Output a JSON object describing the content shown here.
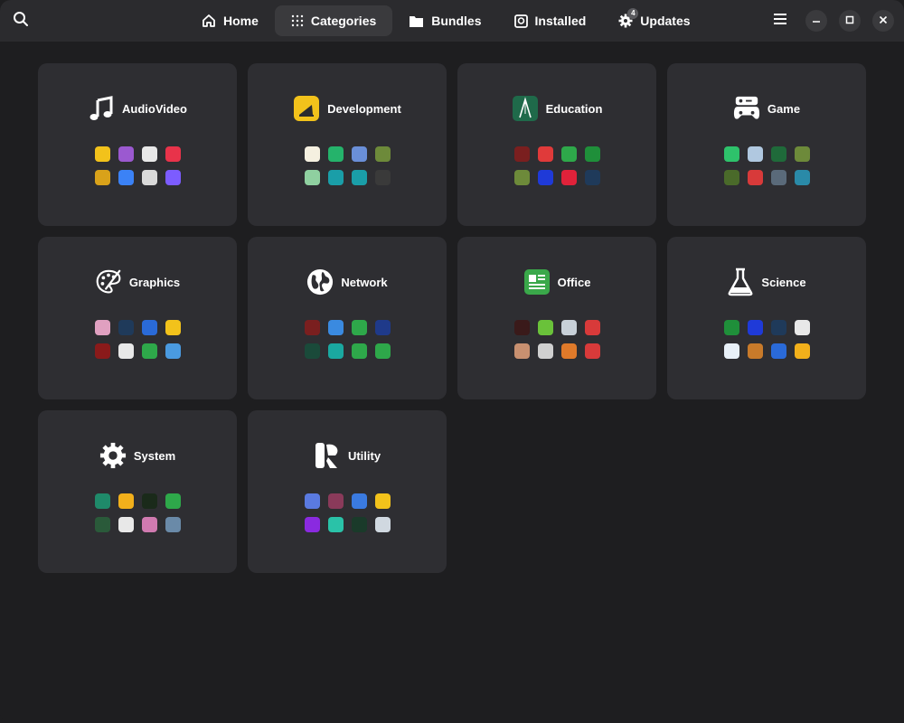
{
  "header": {
    "search_icon": "search-icon",
    "tabs": [
      {
        "label": "Home",
        "icon": "home-icon"
      },
      {
        "label": "Categories",
        "icon": "grid-icon"
      },
      {
        "label": "Bundles",
        "icon": "folder-icon"
      },
      {
        "label": "Installed",
        "icon": "installed-icon"
      },
      {
        "label": "Updates",
        "icon": "gear-icon",
        "badge": "4"
      }
    ],
    "active_tab": "Categories",
    "menu_icon": "hamburger-menu-icon",
    "window_controls": [
      "minimize-icon",
      "maximize-icon",
      "close-icon"
    ]
  },
  "categories": [
    {
      "title": "AudioVideo",
      "icon": "music-note-icon",
      "apps": [
        "#f2c21b",
        "#9b59d0",
        "#e8e8e8",
        "#e8334a",
        "#d9a21a",
        "#3b82f6",
        "#d9d9d9",
        "#7c5cff"
      ]
    },
    {
      "title": "Development",
      "icon": "development-icon",
      "apps": [
        "#f5f0e0",
        "#25b36b",
        "#6a8fd8",
        "#6d8a3a",
        "#8fd0a0",
        "#1a9ea8",
        "#1a9ea8",
        "#3a3a3a"
      ]
    },
    {
      "title": "Education",
      "icon": "education-icon",
      "apps": [
        "#7a1f1f",
        "#e03a3a",
        "#2ea84a",
        "#1f8f3a",
        "#6d8a3a",
        "#1f3ad8",
        "#e0223a",
        "#1f3a5a"
      ]
    },
    {
      "title": "Game",
      "icon": "gamepad-icon",
      "apps": [
        "#2ec26b",
        "#b0c8e0",
        "#1f6a3a",
        "#6d8a3a",
        "#4a6a2a",
        "#d83a3a",
        "#5a6a7a",
        "#2a8aa8"
      ]
    },
    {
      "title": "Graphics",
      "icon": "palette-icon",
      "apps": [
        "#e0a0c0",
        "#1f3a5a",
        "#2a6ad8",
        "#f2c21b",
        "#8a1a1a",
        "#e8e8e8",
        "#2ea84a",
        "#4a9ae0"
      ]
    },
    {
      "title": "Network",
      "icon": "globe-icon",
      "apps": [
        "#7a1f1f",
        "#3a8ae0",
        "#2ea84a",
        "#1f3a8a",
        "#1a4a3a",
        "#1aa8a0",
        "#2ea84a",
        "#2ea84a"
      ]
    },
    {
      "title": "Office",
      "icon": "office-icon",
      "apps": [
        "#3a1a1a",
        "#6ac23a",
        "#c8d0d8",
        "#d83a3a",
        "#c89070",
        "#d0d0d0",
        "#e07a2a",
        "#d83a3a"
      ]
    },
    {
      "title": "Science",
      "icon": "flask-icon",
      "apps": [
        "#1f8f3a",
        "#1f3ad8",
        "#1f3a5a",
        "#e8e8e8",
        "#e8f0f8",
        "#c87a2a",
        "#2a6ad8",
        "#f2b01b"
      ]
    },
    {
      "title": "System",
      "icon": "gear-icon",
      "apps": [
        "#1f8a6a",
        "#f2b01b",
        "#1a2a1a",
        "#2ea84a",
        "#2a5a3a",
        "#e8e8e8",
        "#d07ab0",
        "#6a8aa8"
      ]
    },
    {
      "title": "Utility",
      "icon": "utility-icon",
      "apps": [
        "#5a7ae0",
        "#8a3a5a",
        "#3a7ae0",
        "#f2c21b",
        "#8a2ae0",
        "#2ac2a8",
        "#1a3a2a",
        "#d0d8e0"
      ]
    }
  ]
}
